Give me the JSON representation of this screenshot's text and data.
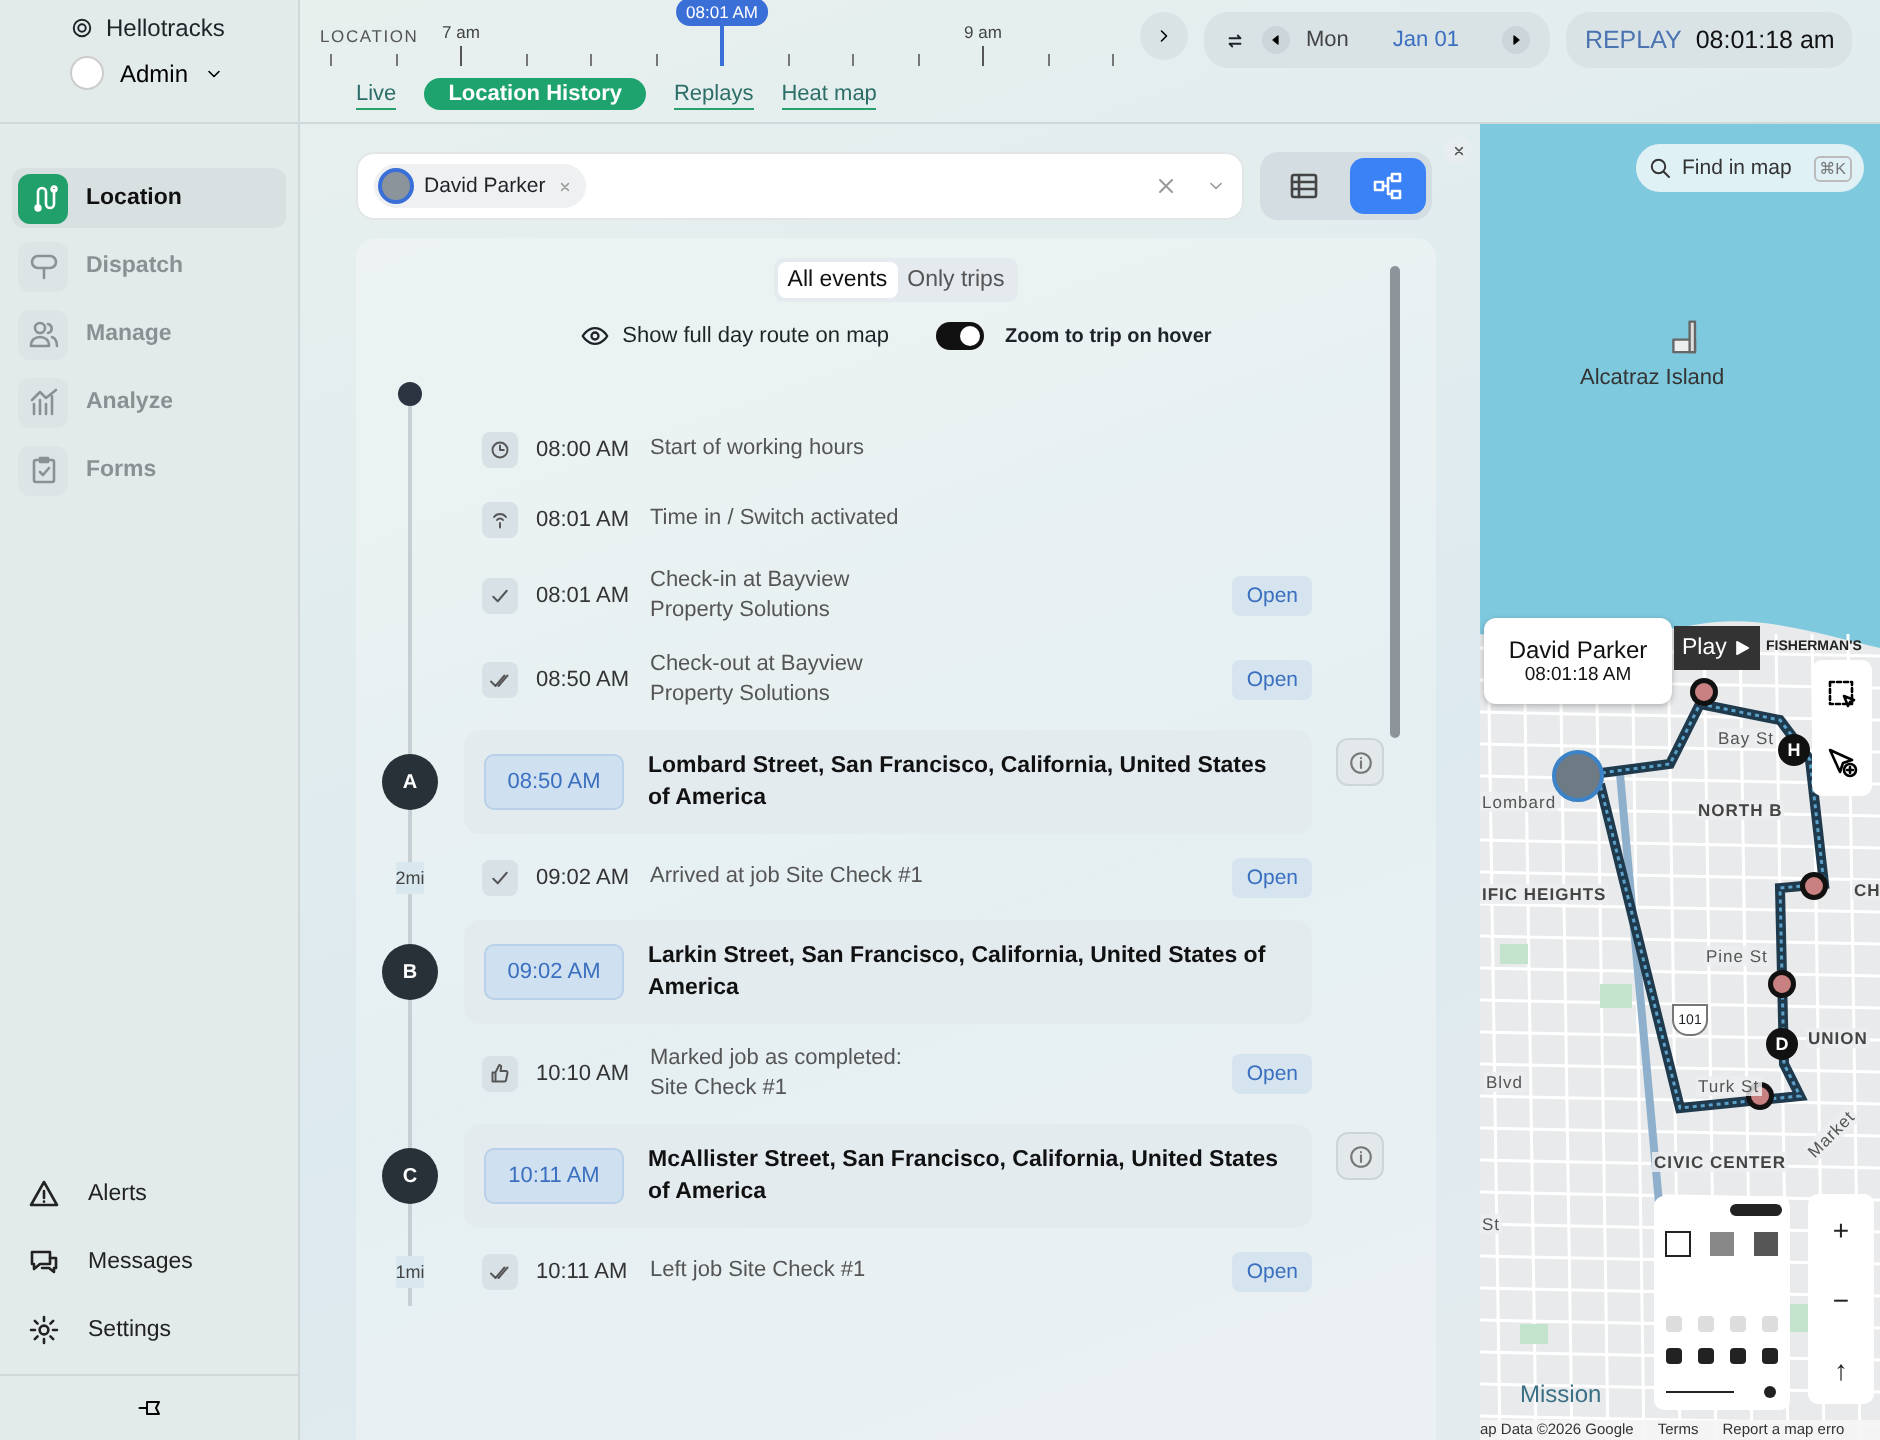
{
  "sidebar": {
    "brand": "Hellotracks",
    "account": {
      "name": "Admin"
    },
    "nav": [
      {
        "label": "Location",
        "selected": true
      },
      {
        "label": "Dispatch",
        "selected": false
      },
      {
        "label": "Manage",
        "selected": false
      },
      {
        "label": "Analyze",
        "selected": false
      },
      {
        "label": "Forms",
        "selected": false
      }
    ],
    "footer": [
      {
        "label": "Alerts"
      },
      {
        "label": "Messages"
      },
      {
        "label": "Settings"
      }
    ]
  },
  "timeline": {
    "label": "LOCATION",
    "hours": [
      {
        "kind": "hour",
        "label": "7 am"
      },
      {
        "kind": "now",
        "label": "08:01 AM"
      },
      {
        "kind": "hour",
        "label": "9 am"
      }
    ]
  },
  "tabs": [
    {
      "label": "Live",
      "selected": false
    },
    {
      "label": "Location History",
      "selected": true
    },
    {
      "label": "Replays",
      "selected": false
    },
    {
      "label": "Heat map",
      "selected": false
    }
  ],
  "date": {
    "day": "Mon",
    "date": "Jan 01"
  },
  "replay": {
    "label": "REPLAY",
    "time": "08:01:18 am"
  },
  "filter": {
    "people": [
      {
        "name": "David Parker"
      }
    ]
  },
  "views": [
    {
      "selected": false
    },
    {
      "selected": true
    }
  ],
  "events_filter": [
    {
      "label": "All events",
      "selected": true
    },
    {
      "label": "Only trips",
      "selected": false
    }
  ],
  "options": {
    "route_label": "Show full day route on map",
    "zoom_label": "Zoom to trip on hover",
    "zoom_on": true
  },
  "entries": [
    {
      "kind": "start"
    },
    {
      "kind": "event",
      "time": "08:00 AM",
      "text": "Start of working hours"
    },
    {
      "kind": "event",
      "time": "08:01 AM",
      "text": "Time in / Switch activated"
    },
    {
      "kind": "event",
      "time": "08:01 AM",
      "text": "Check-in at Bayview Property Solutions",
      "action": "Open"
    },
    {
      "kind": "event",
      "time": "08:50 AM",
      "text": "Check-out at Bayview Property Solutions",
      "action": "Open"
    },
    {
      "kind": "stop",
      "marker": "A",
      "time": "08:50 AM",
      "address": "Lombard Street, San Francisco, California, United States of America",
      "info": true
    },
    {
      "kind": "event",
      "time": "09:02 AM",
      "text": "Arrived at job Site Check #1",
      "action": "Open",
      "distance": "2mi"
    },
    {
      "kind": "stop",
      "marker": "B",
      "time": "09:02 AM",
      "address": "Larkin Street, San Francisco, California, United States of America",
      "info": false
    },
    {
      "kind": "event",
      "time": "10:10 AM",
      "text": "Marked job as completed: Site Check #1",
      "action": "Open"
    },
    {
      "kind": "stop",
      "marker": "C",
      "time": "10:11 AM",
      "address": "McAllister Street, San Francisco, California, United States of America",
      "info": true
    },
    {
      "kind": "event",
      "time": "10:11 AM",
      "text": "Left job Site Check #1",
      "action": "Open",
      "distance": "1mi"
    }
  ],
  "map": {
    "search_placeholder": "Find in map",
    "shortcut": "⌘K",
    "popup": {
      "name": "David Parker",
      "time": "08:01:18 AM"
    },
    "play_label": "Play",
    "places": [
      "Alcatraz Island",
      "FISHERMAN'S",
      "Bay St",
      "NORTH B",
      "Lombard",
      "IFIC HEIGHTS",
      "CH",
      "Pine St",
      "UNION",
      "Blvd",
      "Turk St",
      "Market",
      "CIVIC CENTER",
      "St",
      "Mission"
    ],
    "markers": [
      "H",
      "D"
    ],
    "highway": "101",
    "zoom": [
      "+",
      "−",
      "↑"
    ],
    "attribution": [
      "ap Data ©2026 Google",
      "Terms",
      "Report a map erro"
    ]
  }
}
